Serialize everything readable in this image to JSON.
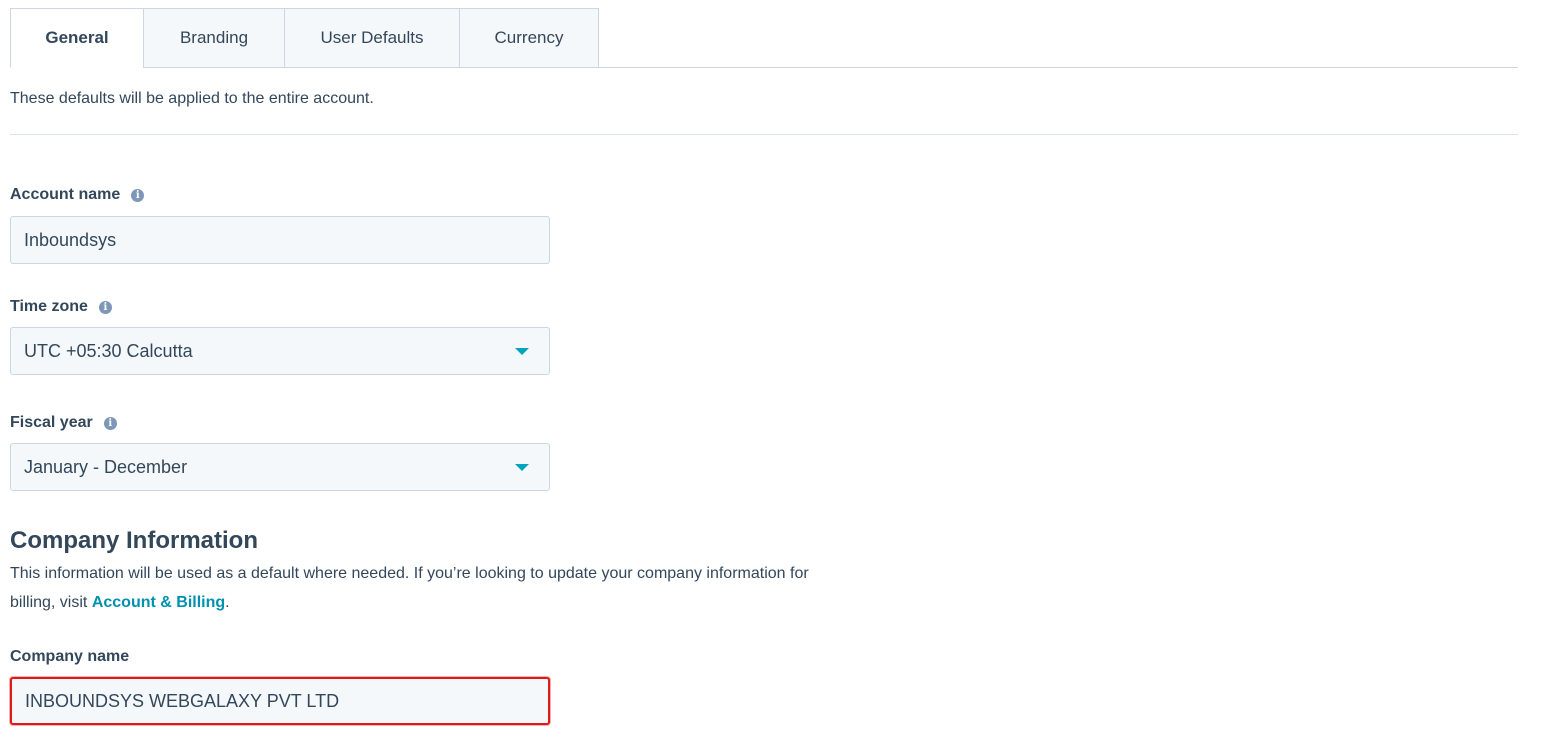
{
  "tabs": [
    {
      "label": "General",
      "active": true
    },
    {
      "label": "Branding",
      "active": false
    },
    {
      "label": "User Defaults",
      "active": false
    },
    {
      "label": "Currency",
      "active": false
    }
  ],
  "intro_text": "These defaults will be applied to the entire account.",
  "fields": {
    "account_name": {
      "label": "Account name",
      "value": "Inboundsys",
      "icon": "info-icon"
    },
    "time_zone": {
      "label": "Time zone",
      "value": "UTC +05:30 Calcutta",
      "icon": "info-icon"
    },
    "fiscal_year": {
      "label": "Fiscal year",
      "value": "January - December",
      "icon": "info-icon"
    },
    "company_name": {
      "label": "Company name",
      "value": "INBOUNDSYS WEBGALAXY PVT LTD"
    }
  },
  "company_section": {
    "title": "Company Information",
    "desc_part1": "This information will be used as a default where needed. If you’re looking to update your company information for billing, visit ",
    "link_text": "Account & Billing",
    "desc_part2": "."
  },
  "colors": {
    "accent": "#00a4bd",
    "link": "#0091ae",
    "highlight_border": "#dd1a1a",
    "text": "#33475b"
  }
}
